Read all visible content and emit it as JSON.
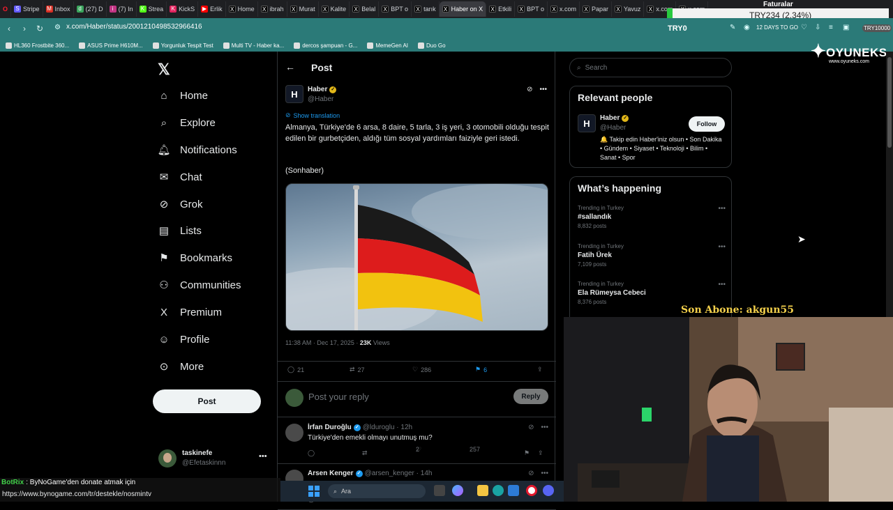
{
  "browser": {
    "tabs": [
      {
        "label": "Stripe",
        "fav": "S",
        "color": "#635bff"
      },
      {
        "label": "Inbox",
        "fav": "M",
        "color": "#d93025"
      },
      {
        "label": "(27) D",
        "fav": "d",
        "color": "#3ba55d"
      },
      {
        "label": "(7) In",
        "fav": "i",
        "color": "#c13584"
      },
      {
        "label": "Strea",
        "fav": "K",
        "color": "#53fc18"
      },
      {
        "label": "KickS",
        "fav": "K",
        "color": "#e0245e"
      },
      {
        "label": "Erlik",
        "fav": "▶",
        "color": "#ff0000"
      },
      {
        "label": "Home",
        "fav": "X",
        "color": "#000000"
      },
      {
        "label": "ibrah",
        "fav": "X",
        "color": "#000000"
      },
      {
        "label": "Murat",
        "fav": "X",
        "color": "#000000"
      },
      {
        "label": "Kalite",
        "fav": "X",
        "color": "#000000"
      },
      {
        "label": "Belal",
        "fav": "X",
        "color": "#000000"
      },
      {
        "label": "BPT o",
        "fav": "X",
        "color": "#000000"
      },
      {
        "label": "tarık",
        "fav": "X",
        "color": "#000000"
      },
      {
        "label": "Haber on X",
        "fav": "X",
        "color": "#000000",
        "active": true
      },
      {
        "label": "Etkili",
        "fav": "X",
        "color": "#000000"
      },
      {
        "label": "BPT o",
        "fav": "X",
        "color": "#000000"
      },
      {
        "label": "x.com",
        "fav": "X",
        "color": "#000000"
      },
      {
        "label": "Papar",
        "fav": "X",
        "color": "#000000"
      },
      {
        "label": "Yavuz",
        "fav": "X",
        "color": "#000000"
      },
      {
        "label": "x.com",
        "fav": "X",
        "color": "#000000"
      },
      {
        "label": "x.com",
        "fav": "X",
        "color": "#000000"
      }
    ],
    "url": "x.com/Haber/status/2001210498532966416",
    "bookmarks": [
      "HL360 Frostbite 360...",
      "ASUS Prime H610M...",
      "Yorgunluk Tespit Test",
      "Multi TV - Haber ka...",
      "dercos şampuan - G...",
      "MemeGen AI",
      "Duo Go"
    ],
    "extension": {
      "balance": "TRY0",
      "days": "12 DAYS TO GO",
      "badge": "TRY10000"
    }
  },
  "tracker": {
    "title": "Faturalar",
    "value": "TRY234 (2.34%)"
  },
  "brand_overlay": {
    "name": "OYUNEKS",
    "site": "www.oyuneks.com"
  },
  "nav": {
    "items": [
      {
        "label": "Home",
        "icon": "home-icon",
        "glyph": "⌂"
      },
      {
        "label": "Explore",
        "icon": "search-icon",
        "glyph": "⌕"
      },
      {
        "label": "Notifications",
        "icon": "bell-icon",
        "glyph": "🔔︎"
      },
      {
        "label": "Chat",
        "icon": "mail-icon",
        "glyph": "✉"
      },
      {
        "label": "Grok",
        "icon": "grok-icon",
        "glyph": "⊘"
      },
      {
        "label": "Lists",
        "icon": "list-icon",
        "glyph": "▤"
      },
      {
        "label": "Bookmarks",
        "icon": "bookmark-icon",
        "glyph": "⚑"
      },
      {
        "label": "Communities",
        "icon": "people-icon",
        "glyph": "⚇"
      },
      {
        "label": "Premium",
        "icon": "x-logo-icon",
        "glyph": "X"
      },
      {
        "label": "Profile",
        "icon": "person-icon",
        "glyph": "☺"
      },
      {
        "label": "More",
        "icon": "more-circle-icon",
        "glyph": "⊙"
      }
    ],
    "post_label": "Post",
    "account": {
      "name": "taskinefe",
      "handle": "@Efetaskinnn"
    }
  },
  "main": {
    "header_title": "Post",
    "author": {
      "name": "Haber",
      "handle": "@Haber",
      "initial": "H"
    },
    "translate_label": "Show translation",
    "text": "Almanya, Türkiye'de 6 arsa, 8 daire, 5 tarla, 3 iş yeri, 3 otomobili olduğu tespit edilen bir gurbetçiden, aldığı tüm sosyal yardımları faiziyle geri istedi.",
    "source": "(Sonhaber)",
    "time": "11:38 AM · Dec 17, 2025 · ",
    "views_count": "23K",
    "views_label": " Views",
    "stats": {
      "replies": "21",
      "reposts": "27",
      "likes": "286",
      "bookmarks": "6"
    },
    "reply_placeholder": "Post your reply",
    "reply_button": "Reply",
    "comments": [
      {
        "name": "İrfan Duroğlu",
        "handle": "@lduroglu · 12h",
        "text": "Türkiye'den emekli olmayı unutmuş mu?",
        "replies": "",
        "reposts": "",
        "likes": "2",
        "views": "257"
      },
      {
        "name": "Arsen Kenger",
        "handle": "@arsen_kenger · 14h",
        "text": "",
        "replies": "",
        "reposts": "",
        "likes": "",
        "views": ""
      }
    ]
  },
  "sidebar": {
    "search_placeholder": "Search",
    "relevant_title": "Relevant people",
    "person": {
      "name": "Haber",
      "handle": "@Haber",
      "initial": "H",
      "follow": "Follow",
      "bio": "🔔 Takip edin Haber'iniz olsun • Son Dakika • Gündem • Siyaset • Teknoloji • Bilim • Sanat • Spor"
    },
    "happening_title": "What’s happening",
    "trends": [
      {
        "context": "Trending in Turkey",
        "name": "#sallandık",
        "count": "8,832 posts"
      },
      {
        "context": "Trending in Turkey",
        "name": "Fatih Ürek",
        "count": "7,109 posts"
      },
      {
        "context": "Trending in Turkey",
        "name": "Ela Rümeysa Cebeci",
        "count": "8,376 posts"
      }
    ]
  },
  "overlays": {
    "son_abone": "Son Abone: akgun55",
    "botrix_name": "BotRix",
    "botrix_msg": ": ByNoGame'den donate atmak için",
    "botrix_link": "https://www.bynogame.com/tr/destekle/nosmintv"
  },
  "taskbar": {
    "search_label": "Ara"
  }
}
